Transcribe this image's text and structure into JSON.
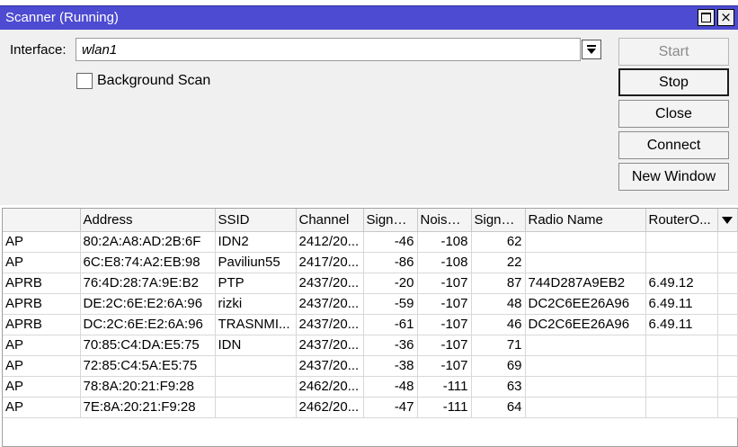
{
  "window": {
    "title": "Scanner (Running)",
    "maximize_icon": "maximize-icon",
    "close_icon": "close-icon",
    "close_glyph": "×",
    "titlebar_color": "#4d4bd1"
  },
  "form": {
    "interface_label": "Interface:",
    "interface_value": "wlan1",
    "background_scan_label": "Background Scan",
    "background_scan_checked": false
  },
  "buttons": {
    "start": "Start",
    "stop": "Stop",
    "close": "Close",
    "connect": "Connect",
    "new_window": "New Window"
  },
  "table": {
    "columns": [
      "",
      "Address",
      "SSID",
      "Channel",
      "Signal...",
      "Noise ...",
      "Signal...",
      "Radio Name",
      "RouterO..."
    ],
    "rows": [
      [
        "AP",
        "80:2A:A8:AD:2B:6F",
        "IDN2",
        "2412/20...",
        "-46",
        "-108",
        "62",
        "",
        ""
      ],
      [
        "AP",
        "6C:E8:74:A2:EB:98",
        "Paviliun55",
        "2417/20...",
        "-86",
        "-108",
        "22",
        "",
        ""
      ],
      [
        "APRB",
        "76:4D:28:7A:9E:B2",
        "PTP",
        "2437/20...",
        "-20",
        "-107",
        "87",
        "744D287A9EB2",
        "6.49.12"
      ],
      [
        "APRB",
        "DE:2C:6E:E2:6A:96",
        "rizki",
        "2437/20...",
        "-59",
        "-107",
        "48",
        "DC2C6EE26A96",
        "6.49.11"
      ],
      [
        "APRB",
        "DC:2C:6E:E2:6A:96",
        "TRASNMI...",
        "2437/20...",
        "-61",
        "-107",
        "46",
        "DC2C6EE26A96",
        "6.49.11"
      ],
      [
        "AP",
        "70:85:C4:DA:E5:75",
        "IDN",
        "2437/20...",
        "-36",
        "-107",
        "71",
        "",
        ""
      ],
      [
        "AP",
        "72:85:C4:5A:E5:75",
        "",
        "2437/20...",
        "-38",
        "-107",
        "69",
        "",
        ""
      ],
      [
        "AP",
        "78:8A:20:21:F9:28",
        "",
        "2462/20...",
        "-48",
        "-111",
        "63",
        "",
        ""
      ],
      [
        "AP",
        "7E:8A:20:21:F9:28",
        "",
        "2462/20...",
        "-47",
        "-111",
        "64",
        "",
        ""
      ]
    ]
  }
}
